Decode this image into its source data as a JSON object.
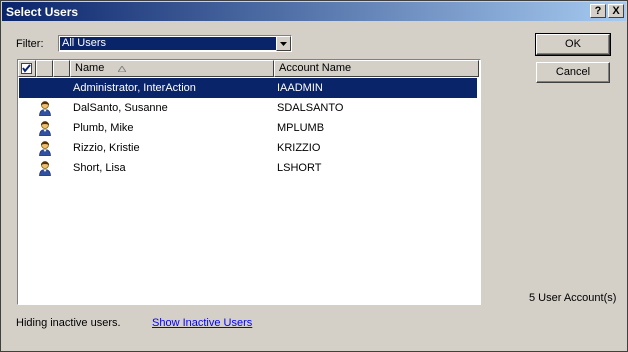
{
  "window": {
    "title": "Select Users",
    "help_button": "?",
    "close_button": "X"
  },
  "filter": {
    "label": "Filter:",
    "value": "All Users"
  },
  "buttons": {
    "ok": "OK",
    "cancel": "Cancel"
  },
  "table": {
    "columns": {
      "name": "Name",
      "account": "Account Name"
    },
    "sorted_by": "name",
    "header_checkbox_checked": true,
    "rows": [
      {
        "name": "Administrator, InterAction",
        "account": "IAADMIN",
        "selected": true,
        "icon": ""
      },
      {
        "name": "DalSanto, Susanne",
        "account": "SDALSANTO",
        "selected": false,
        "icon": "user-icon"
      },
      {
        "name": "Plumb, Mike",
        "account": "MPLUMB",
        "selected": false,
        "icon": "user-icon"
      },
      {
        "name": "Rizzio, Kristie",
        "account": "KRIZZIO",
        "selected": false,
        "icon": "user-icon"
      },
      {
        "name": "Short, Lisa",
        "account": "LSHORT",
        "selected": false,
        "icon": "user-icon"
      }
    ]
  },
  "status": {
    "count": "5 User Account(s)",
    "hiding_text": "Hiding inactive users.",
    "show_inactive_link": "Show Inactive Users"
  },
  "colors": {
    "selection": "#0a246a",
    "face": "#d4d0c8",
    "link": "#0000ff"
  }
}
